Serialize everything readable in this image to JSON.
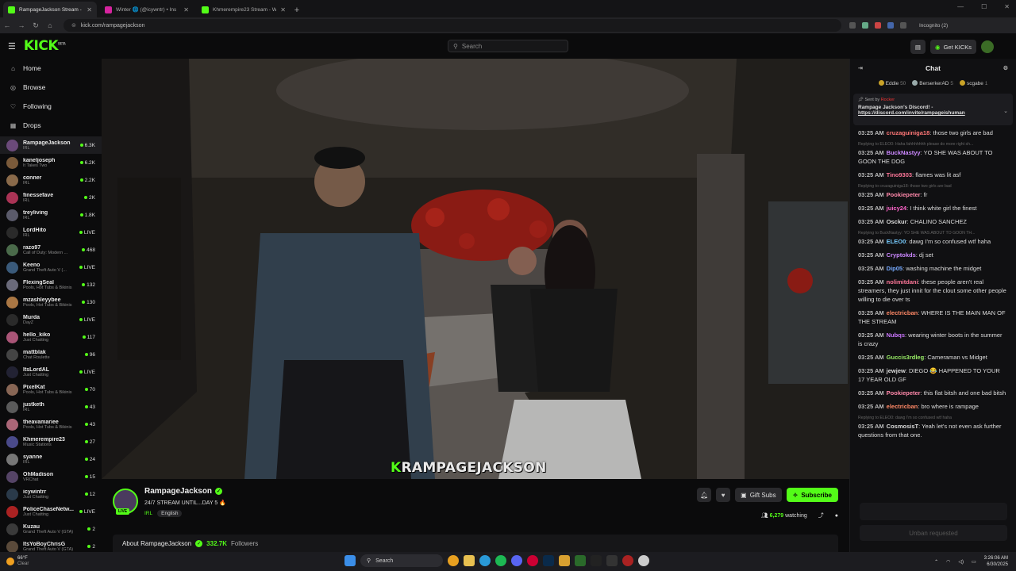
{
  "browser": {
    "tabs": [
      {
        "title": "RampageJackson Stream - ",
        "active": true,
        "color": "#53fc18"
      },
      {
        "title": "Winter 🌐 (@icywntr) • Ins",
        "active": false,
        "color": "#d6249f"
      },
      {
        "title": "Khmerempire23 Stream - Watch",
        "active": false,
        "color": "#53fc18"
      }
    ],
    "url": "kick.com/rampagejackson",
    "incognito_label": "Incognito (2)"
  },
  "site": {
    "logo": "KICK",
    "logo_sup": "BETA",
    "search_placeholder": "Search",
    "get_kicks_label": "Get KICKs",
    "accent": "#53fc18"
  },
  "sidebar": {
    "nav": [
      {
        "label": "Home",
        "icon": "home-icon"
      },
      {
        "label": "Browse",
        "icon": "compass-icon"
      },
      {
        "label": "Following",
        "icon": "heart-icon"
      },
      {
        "label": "Drops",
        "icon": "gift-icon"
      }
    ],
    "channels": [
      {
        "name": "RampageJackson",
        "category": "IRL",
        "viewers": "6.3K",
        "color": "#6b4a7a"
      },
      {
        "name": "kaneljoseph",
        "category": "It Takes Two",
        "viewers": "6.2K",
        "color": "#7a5a3a"
      },
      {
        "name": "conner",
        "category": "IRL",
        "viewers": "2.2K",
        "color": "#8a6a4a"
      },
      {
        "name": "finessefave",
        "category": "IRL",
        "viewers": "2K",
        "color": "#aa3355"
      },
      {
        "name": "treyliving",
        "category": "IRL",
        "viewers": "1.8K",
        "color": "#5a5a6a"
      },
      {
        "name": "LordHito",
        "category": "IRL",
        "viewers": "LIVE",
        "color": "#2a2a2a"
      },
      {
        "name": "razo97",
        "category": "Call of Duty: Modern ...",
        "viewers": "468",
        "color": "#4a6a4a"
      },
      {
        "name": "Keeno",
        "category": "Grand Theft Auto V (...",
        "viewers": "LIVE",
        "color": "#3a5a7a"
      },
      {
        "name": "FlexingSeal",
        "category": "Pools, Hot Tubs & Bikinis",
        "viewers": "132",
        "color": "#6a6a7a"
      },
      {
        "name": "mzashleyybee",
        "category": "Pools, Hot Tubs & Bikinis",
        "viewers": "130",
        "color": "#aa7744"
      },
      {
        "name": "Murda",
        "category": "DayZ",
        "viewers": "LIVE",
        "color": "#2a2a2a"
      },
      {
        "name": "hello_kiko",
        "category": "Just Chatting",
        "viewers": "117",
        "color": "#aa5577"
      },
      {
        "name": "mattblak",
        "category": "Chat Roulette",
        "viewers": "96",
        "color": "#444"
      },
      {
        "name": "ItsLordAL",
        "category": "Just Chatting",
        "viewers": "LIVE",
        "color": "#223"
      },
      {
        "name": "PixelKat",
        "category": "Pools, Hot Tubs & Bikinis",
        "viewers": "70",
        "color": "#886655"
      },
      {
        "name": "justketh",
        "category": "IRL",
        "viewers": "43",
        "color": "#5a5a5a"
      },
      {
        "name": "theavamariee",
        "category": "Pools, Hot Tubs & Bikinis",
        "viewers": "43",
        "color": "#aa6677"
      },
      {
        "name": "Khmerempire23",
        "category": "Music Stations",
        "viewers": "27",
        "color": "#4a4a8a"
      },
      {
        "name": "syanne",
        "category": "IRL",
        "viewers": "24",
        "color": "#777"
      },
      {
        "name": "OhMadison",
        "category": "VRChat",
        "viewers": "15",
        "color": "#554466"
      },
      {
        "name": "icywintrr",
        "category": "Just Chatting",
        "viewers": "12",
        "color": "#2a3a4a"
      },
      {
        "name": "PoliceChaseNetw...",
        "category": "Just Chatting",
        "viewers": "LIVE",
        "color": "#aa2222"
      },
      {
        "name": "Kuzau",
        "category": "Grand Theft Auto V (GTA)",
        "viewers": "2",
        "color": "#3a3a3a"
      },
      {
        "name": "ItsYoBoyChrisG",
        "category": "Grand Theft Auto V (GTA)",
        "viewers": "2",
        "color": "#5a4a3a"
      }
    ]
  },
  "player": {
    "watermark_k": "K",
    "watermark": "RAMPAGEJACKSON"
  },
  "stream": {
    "streamer": "RampageJackson",
    "live_badge": "LIVE",
    "title": "24/7 STREAM UNTIL...DAY 5 🔥",
    "category": "IRL",
    "language": "English",
    "gift_subs_label": "Gift Subs",
    "subscribe_label": "Subscribe",
    "viewers": "6,279",
    "watching_label": "watching",
    "about_label": "About RampageJackson",
    "followers": "332.7K",
    "followers_label": "Followers"
  },
  "chat": {
    "title": "Chat",
    "leaderboard": [
      {
        "name": "Eddie",
        "count": "50"
      },
      {
        "name": "BerserkerAD",
        "count": "5"
      },
      {
        "name": "scgabe",
        "count": "1"
      }
    ],
    "pinned": {
      "sent_by": "Sent by",
      "sender": "Rocker",
      "text": "Rampage Jackson's Discord! -",
      "link": "https://discord.com/invite/rampageishuman"
    },
    "messages": [
      {
        "time": "03:25 AM",
        "user": "cruzaguiniga18",
        "color": "#ff7777",
        "text": "those two girls are bad",
        "reply": ""
      },
      {
        "time": "03:25 AM",
        "user": "BuckNastyy",
        "color": "#cc88ff",
        "text": "YO SHE WAS ABOUT TO GOON THE DOG",
        "reply": "Replying to ELEO0: Haha fahhhhhhh please do more right sh..."
      },
      {
        "time": "03:25 AM",
        "user": "Tino9303",
        "color": "#ff7799",
        "text": "flames was lit asf",
        "reply": ""
      },
      {
        "time": "03:25 AM",
        "user": "Pookiepeter",
        "color": "#ff88aa",
        "text": "fr",
        "reply": "Replying to cruzaguiniga18: those two girls are bad"
      },
      {
        "time": "03:25 AM",
        "user": "juicy24",
        "color": "#ff66cc",
        "text": "I think white girl the finest",
        "reply": ""
      },
      {
        "time": "03:25 AM",
        "user": "Osckur",
        "color": "#dddddd",
        "text": "CHALINO SANCHEZ",
        "reply": ""
      },
      {
        "time": "03:25 AM",
        "user": "ELEO0",
        "color": "#77ccff",
        "text": "dawg I'm so confused wtf haha",
        "reply": "Replying to BuckNastyy: YO SHE WAS ABOUT TO GOON TH..."
      },
      {
        "time": "03:25 AM",
        "user": "Cryptokds",
        "color": "#cc88ff",
        "text": "dj set",
        "reply": ""
      },
      {
        "time": "03:25 AM",
        "user": "Dip05",
        "color": "#77aaff",
        "text": "washing machine the midget",
        "reply": ""
      },
      {
        "time": "03:25 AM",
        "user": "nolimitdani",
        "color": "#ff7799",
        "text": "these people aren't real streamers, they just innit for the clout some other people willing to die over ts",
        "reply": ""
      },
      {
        "time": "03:25 AM",
        "user": "electricban",
        "color": "#ff8866",
        "text": "WHERE IS THE MAIN MAN OF THE STREAM",
        "reply": ""
      },
      {
        "time": "03:25 AM",
        "user": "Nubqs",
        "color": "#cc77ff",
        "text": "wearing winter boots in the summer is crazy",
        "reply": ""
      },
      {
        "time": "03:25 AM",
        "user": "Guccis3rdleg",
        "color": "#99ee66",
        "text": "Cameraman vs Midget",
        "reply": ""
      },
      {
        "time": "03:25 AM",
        "user": "jewjew",
        "color": "#dddddd",
        "text": "DIEGO 😂 HAPPENED TO YOUR 17 YEAR OLD GF",
        "reply": ""
      },
      {
        "time": "03:25 AM",
        "user": "Pookiepeter",
        "color": "#ff88aa",
        "text": "this flat bitsh and one bad bitsh",
        "reply": ""
      },
      {
        "time": "03:25 AM",
        "user": "electricban",
        "color": "#ff8866",
        "text": "bro where is rampage",
        "reply": ""
      },
      {
        "time": "03:25 AM",
        "user": "CosmosisT",
        "color": "#dddddd",
        "text": "Yeah let's not even ask further questions from that one.",
        "reply": "Replying to ELEO0: dawg I'm so confused wtf haha"
      }
    ],
    "unban_label": "Unban requested"
  },
  "taskbar": {
    "temp": "66°F",
    "condition": "Clear",
    "search_label": "Search",
    "time": "3:26:06 AM",
    "date": "6/30/2025"
  }
}
